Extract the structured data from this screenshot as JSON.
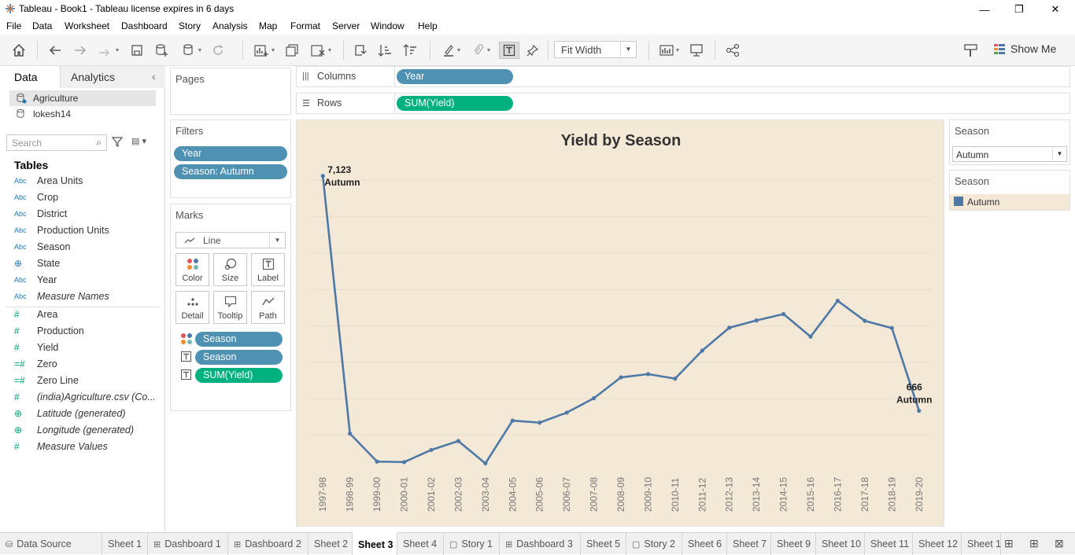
{
  "window": {
    "title": "Tableau - Book1 - Tableau license expires in 6 days"
  },
  "menu": [
    "File",
    "Data",
    "Worksheet",
    "Dashboard",
    "Story",
    "Analysis",
    "Map",
    "Format",
    "Server",
    "Window",
    "Help"
  ],
  "toolbar": {
    "fit_label": "Fit Width",
    "show_me_label": "Show Me"
  },
  "data_pane": {
    "tab_data": "Data",
    "tab_analytics": "Analytics",
    "datasources": [
      "Agriculture",
      "lokesh14"
    ],
    "search_placeholder": "Search",
    "tables_heading": "Tables",
    "dimensions": [
      {
        "type": "Abc",
        "name": "Area Units"
      },
      {
        "type": "Abc",
        "name": "Crop"
      },
      {
        "type": "Abc",
        "name": "District"
      },
      {
        "type": "Abc",
        "name": "Production Units"
      },
      {
        "type": "Abc",
        "name": "Season"
      },
      {
        "type": "globe",
        "name": "State"
      },
      {
        "type": "Abc",
        "name": "Year"
      },
      {
        "type": "Abc",
        "name": "Measure Names"
      }
    ],
    "measures": [
      {
        "type": "#",
        "name": "Area"
      },
      {
        "type": "#",
        "name": "Production"
      },
      {
        "type": "#",
        "name": "Yield"
      },
      {
        "type": "=#",
        "name": "Zero"
      },
      {
        "type": "=#",
        "name": "Zero Line"
      },
      {
        "type": "#",
        "name": "(india)Agriculture.csv (Co..."
      },
      {
        "type": "globe",
        "name": "Latitude (generated)"
      },
      {
        "type": "globe",
        "name": "Longitude (generated)"
      },
      {
        "type": "#",
        "name": "Measure Values"
      }
    ]
  },
  "pages": {
    "title": "Pages"
  },
  "filters": {
    "title": "Filters",
    "items": [
      "Year",
      "Season: Autumn"
    ]
  },
  "marks": {
    "title": "Marks",
    "type": "Line",
    "buttons": [
      "Color",
      "Size",
      "Label",
      "Detail",
      "Tooltip",
      "Path"
    ],
    "pills": [
      {
        "icon": "color",
        "label": "Season"
      },
      {
        "icon": "text",
        "label": "Season"
      },
      {
        "icon": "text",
        "label": "SUM(Yield)"
      }
    ]
  },
  "shelves": {
    "columns_label": "Columns",
    "columns_pill": "Year",
    "rows_label": "Rows",
    "rows_pill": "SUM(Yield)"
  },
  "season_filter": {
    "title": "Season",
    "value": "Autumn"
  },
  "season_legend": {
    "title": "Season",
    "item": "Autumn",
    "color": "#4e79a7"
  },
  "chart_data": {
    "type": "line",
    "title": "Yield by Season",
    "xlabel": "",
    "ylabel": "",
    "x": [
      "1997-98",
      "1998-99",
      "1999-00",
      "2000-01",
      "2001-02",
      "2002-03",
      "2003-04",
      "2004-05",
      "2005-06",
      "2006-07",
      "2007-08",
      "2008-09",
      "2009-10",
      "2010-11",
      "2011-12",
      "2012-13",
      "2013-14",
      "2014-15",
      "2015-16",
      "2016-17",
      "2017-18",
      "2018-19",
      "2019-20"
    ],
    "series": [
      {
        "name": "Autumn",
        "values": [
          7123,
          40,
          -730,
          -745,
          -410,
          -165,
          -780,
          395,
          340,
          615,
          1010,
          1585,
          1675,
          1550,
          2320,
          2950,
          3150,
          3325,
          2705,
          3690,
          3140,
          2940,
          666
        ]
      }
    ],
    "ylim": [
      -900,
      7400
    ],
    "grid": true,
    "legend": "right",
    "annotations": [
      {
        "x": "1997-98",
        "value": "7,123",
        "label": "Autumn"
      },
      {
        "x": "2019-20",
        "value": "666",
        "label": "Autumn"
      }
    ],
    "line_color": "#4e79a7"
  },
  "bottom_tabs": [
    {
      "label": "Data Source",
      "icon": "ds"
    },
    {
      "label": "Sheet 1",
      "icon": ""
    },
    {
      "label": "Dashboard 1",
      "icon": "dash"
    },
    {
      "label": "Dashboard 2",
      "icon": "dash"
    },
    {
      "label": "Sheet 2",
      "icon": ""
    },
    {
      "label": "Sheet 3",
      "icon": "",
      "active": true
    },
    {
      "label": "Sheet 4",
      "icon": ""
    },
    {
      "label": "Story 1",
      "icon": "story"
    },
    {
      "label": "Dashboard 3",
      "icon": "dash"
    },
    {
      "label": "Sheet 5",
      "icon": ""
    },
    {
      "label": "Story 2",
      "icon": "story"
    },
    {
      "label": "Sheet 6",
      "icon": ""
    },
    {
      "label": "Sheet 7",
      "icon": ""
    },
    {
      "label": "Sheet 9",
      "icon": ""
    },
    {
      "label": "Sheet 10",
      "icon": ""
    },
    {
      "label": "Sheet 11",
      "icon": ""
    },
    {
      "label": "Sheet 12",
      "icon": ""
    },
    {
      "label": "Sheet 1",
      "icon": ""
    }
  ]
}
